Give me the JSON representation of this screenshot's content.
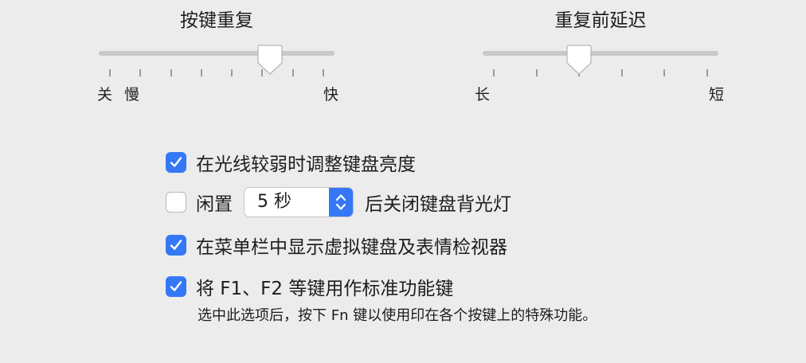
{
  "key_repeat": {
    "title": "按键重复",
    "min_label": "关",
    "slow_label": "慢",
    "max_label": "快",
    "value": 0.75
  },
  "delay_until_repeat": {
    "title": "重复前延迟",
    "min_label": "长",
    "max_label": "短",
    "value": 0.4
  },
  "options": {
    "adjust_brightness": {
      "label": "在光线较弱时调整键盘亮度",
      "checked": true
    },
    "backlight_off": {
      "prefix": "闲置",
      "selected": "5 秒",
      "suffix": "后关闭键盘背光灯",
      "checked": false
    },
    "show_viewer": {
      "label": "在菜单栏中显示虚拟键盘及表情检视器",
      "checked": true
    },
    "function_keys": {
      "label": "将 F1、F2 等键用作标准功能键",
      "checked": true,
      "note": "选中此选项后，按下 Fn 键以使用印在各个按键上的特殊功能。"
    }
  },
  "colors": {
    "accent": "#3478f6",
    "track": "#c9c9c9"
  }
}
